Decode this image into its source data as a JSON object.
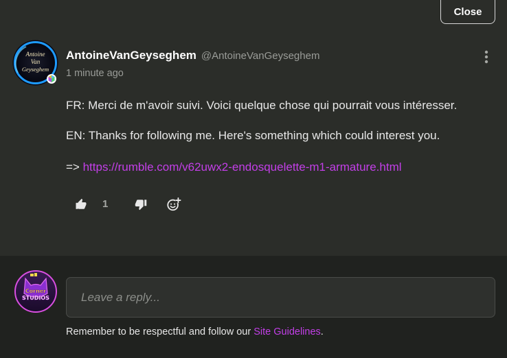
{
  "close_label": "Close",
  "comment": {
    "avatar_text": [
      "Antoine",
      "Van",
      "Geyseghem"
    ],
    "author_name": "AntoineVanGeyseghem",
    "author_handle": "@AntoineVanGeyseghem",
    "timestamp": "1 minute ago",
    "paragraph_fr": "FR: Merci de m'avoir suivi. Voici quelque chose qui pourrait vous intéresser.",
    "paragraph_en": "EN: Thanks for following me. Here's something which could interest you.",
    "link_prefix": "=> ",
    "link_url": "https://rumble.com/v62uwx2-endosquelette-m1-armature.html",
    "like_count": "1"
  },
  "reply": {
    "avatar_text": [
      "Corner",
      "STUDIOS"
    ],
    "placeholder": "Leave a reply...",
    "guidelines_prefix": "Remember to be respectful and follow our ",
    "guidelines_link": "Site Guidelines",
    "guidelines_suffix": "."
  },
  "colors": {
    "background": "#2b2d29",
    "reply_background": "#20221f",
    "link": "#c33fe8",
    "muted_text": "#9a9c98",
    "avatar_ring": "#1e9bff",
    "reply_avatar_ring": "#d94fe0"
  },
  "icons": {
    "more": "vertical-dots-icon",
    "like": "thumbs-up-icon",
    "dislike": "thumbs-down-icon",
    "react": "add-reaction-icon",
    "badge": "verified-badge-icon"
  }
}
